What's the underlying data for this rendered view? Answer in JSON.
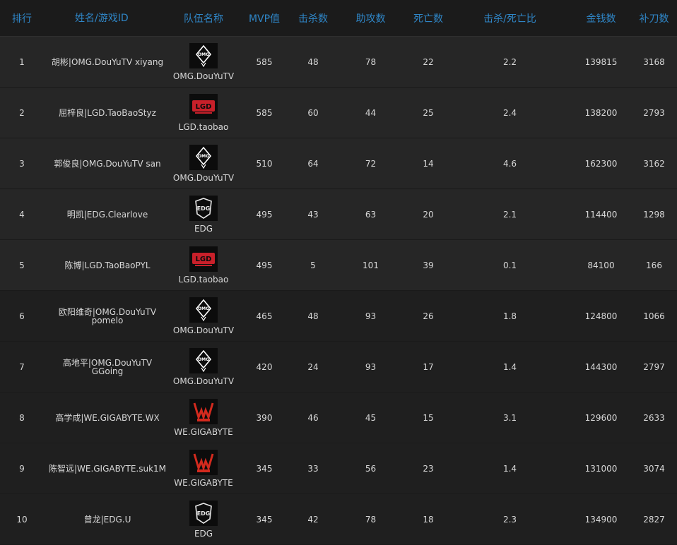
{
  "headers": {
    "rank": "排行",
    "name": "姓名/游戏ID",
    "team": "队伍名称",
    "mvp": "MVP值",
    "kills": "击杀数",
    "assists": "助攻数",
    "deaths": "死亡数",
    "kd": "击杀/死亡比",
    "gold": "金钱数",
    "cs": "补刀数"
  },
  "colors": {
    "header_text": "#2f86c7",
    "omg_logo": "#ffffff",
    "lgd_logo": "#c8202a",
    "we_logo": "#d42a1e",
    "edg_logo": "#e8e8e8"
  },
  "rows": [
    {
      "rank": "1",
      "name": "胡彬|OMG.DouYuTV xiyang",
      "team": "OMG.DouYuTV",
      "logo": "omg-logo-icon",
      "mvp": "585",
      "kills": "48",
      "assists": "78",
      "deaths": "22",
      "kd": "2.2",
      "gold": "139815",
      "cs": "3168"
    },
    {
      "rank": "2",
      "name": "屈梓良|LGD.TaoBaoStyz",
      "team": "LGD.taobao",
      "logo": "lgd-logo-icon",
      "mvp": "585",
      "kills": "60",
      "assists": "44",
      "deaths": "25",
      "kd": "2.4",
      "gold": "138200",
      "cs": "2793"
    },
    {
      "rank": "3",
      "name": "郭俊良|OMG.DouYuTV san",
      "team": "OMG.DouYuTV",
      "logo": "omg-logo-icon",
      "mvp": "510",
      "kills": "64",
      "assists": "72",
      "deaths": "14",
      "kd": "4.6",
      "gold": "162300",
      "cs": "3162"
    },
    {
      "rank": "4",
      "name": "明凯|EDG.Clearlove",
      "team": "EDG",
      "logo": "edg-logo-icon",
      "mvp": "495",
      "kills": "43",
      "assists": "63",
      "deaths": "20",
      "kd": "2.1",
      "gold": "114400",
      "cs": "1298"
    },
    {
      "rank": "5",
      "name": "陈博|LGD.TaoBaoPYL",
      "team": "LGD.taobao",
      "logo": "lgd-logo-icon",
      "mvp": "495",
      "kills": "5",
      "assists": "101",
      "deaths": "39",
      "kd": "0.1",
      "gold": "84100",
      "cs": "166"
    },
    {
      "rank": "6",
      "name": "欧阳维奇|OMG.DouYuTV pomelo",
      "team": "OMG.DouYuTV",
      "logo": "omg-logo-icon",
      "mvp": "465",
      "kills": "48",
      "assists": "93",
      "deaths": "26",
      "kd": "1.8",
      "gold": "124800",
      "cs": "1066"
    },
    {
      "rank": "7",
      "name": "高地平|OMG.DouYuTV GGoing",
      "team": "OMG.DouYuTV",
      "logo": "omg-logo-icon",
      "mvp": "420",
      "kills": "24",
      "assists": "93",
      "deaths": "17",
      "kd": "1.4",
      "gold": "144300",
      "cs": "2797"
    },
    {
      "rank": "8",
      "name": "高学成|WE.GIGABYTE.WX",
      "team": "WE.GIGABYTE",
      "logo": "we-logo-icon",
      "mvp": "390",
      "kills": "46",
      "assists": "45",
      "deaths": "15",
      "kd": "3.1",
      "gold": "129600",
      "cs": "2633"
    },
    {
      "rank": "9",
      "name": "陈智远|WE.GIGABYTE.suk1M",
      "team": "WE.GIGABYTE",
      "logo": "we-logo-icon",
      "mvp": "345",
      "kills": "33",
      "assists": "56",
      "deaths": "23",
      "kd": "1.4",
      "gold": "131000",
      "cs": "3074"
    },
    {
      "rank": "10",
      "name": "曾龙|EDG.U",
      "team": "EDG",
      "logo": "edg-logo-icon",
      "mvp": "345",
      "kills": "42",
      "assists": "78",
      "deaths": "18",
      "kd": "2.3",
      "gold": "134900",
      "cs": "2827"
    }
  ]
}
